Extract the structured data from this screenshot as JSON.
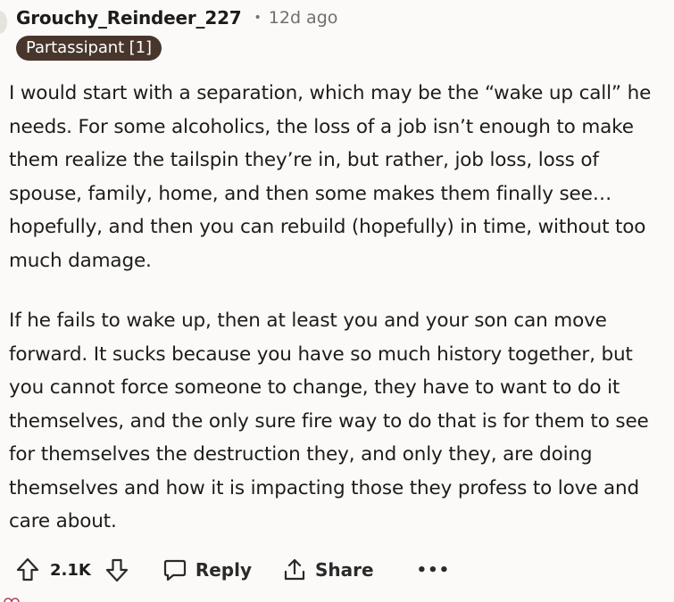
{
  "comment": {
    "username": "Grouchy_Reindeer_227",
    "separator": "•",
    "time": "12d ago",
    "flair": "Partassipant [1]",
    "paragraphs": [
      "I would start with a separation, which may be the “wake up call” he needs. For some alcoholics, the loss of a job isn’t enough to make them realize the tailspin they’re in, but rather, job loss, loss of spouse, family, home, and then some makes them finally see…hopefully, and then you can rebuild (hopefully) in time, without too much damage.",
      "If he fails to wake up, then at least you and your son can move forward. It sucks because you have so much history together, but you cannot force someone to change, they have to want to do it themselves, and the only sure fire way to do that is for them to see for themselves the destruction they, and only they, are doing themselves and how it is impacting those they profess to love and care about."
    ]
  },
  "actions": {
    "score": "2.1K",
    "reply_label": "Reply",
    "share_label": "Share",
    "more_label": "•••"
  },
  "icons": {
    "upvote": "upvote-arrow-icon",
    "downvote": "downvote-arrow-icon",
    "reply": "comment-bubble-icon",
    "share": "share-upload-icon",
    "more": "ellipsis-icon"
  },
  "colors": {
    "background": "#fbfaf8",
    "flair_bg": "#48362c",
    "text": "#1c1c1c",
    "muted": "#6f6f6f"
  }
}
